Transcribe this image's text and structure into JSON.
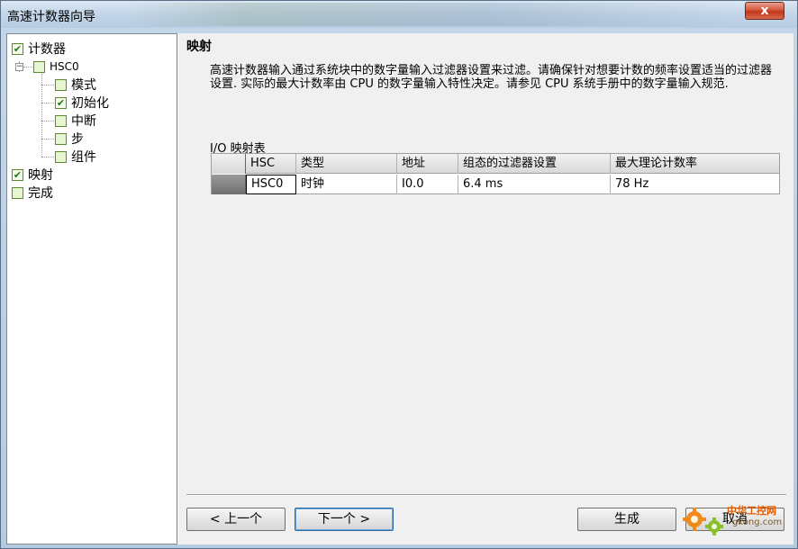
{
  "window": {
    "title": "高速计数器向导",
    "close_label": "x"
  },
  "tree": {
    "items": [
      {
        "label": "计数器",
        "checked": true
      },
      {
        "label": "HSC0",
        "checked": false
      },
      {
        "label": "模式",
        "checked": false
      },
      {
        "label": "初始化",
        "checked": true
      },
      {
        "label": "中断",
        "checked": false
      },
      {
        "label": "步",
        "checked": false
      },
      {
        "label": "组件",
        "checked": false
      },
      {
        "label": "映射",
        "checked": true
      },
      {
        "label": "完成",
        "checked": false
      }
    ]
  },
  "main": {
    "section_title": "映射",
    "description": "高速计数器输入通过系统块中的数字量输入过滤器设置来过滤。请确保针对想要计数的频率设置适当的过滤器设置. 实际的最大计数率由 CPU 的数字量输入特性决定。请参见 CPU 系统手册中的数字量输入规范.",
    "table_caption": "I/O 映射表",
    "table": {
      "headers": [
        "HSC",
        "类型",
        "地址",
        "组态的过滤器设置",
        "最大理论计数率"
      ],
      "rows": [
        [
          "HSC0",
          "时钟",
          "I0.0",
          "6.4 ms",
          "78 Hz"
        ]
      ]
    }
  },
  "buttons": {
    "prev": "< 上一个",
    "next": "下一个 >",
    "generate": "生成",
    "cancel": "取消"
  },
  "watermark": {
    "line1": "中华工控网",
    "line2": "gkong.com"
  }
}
